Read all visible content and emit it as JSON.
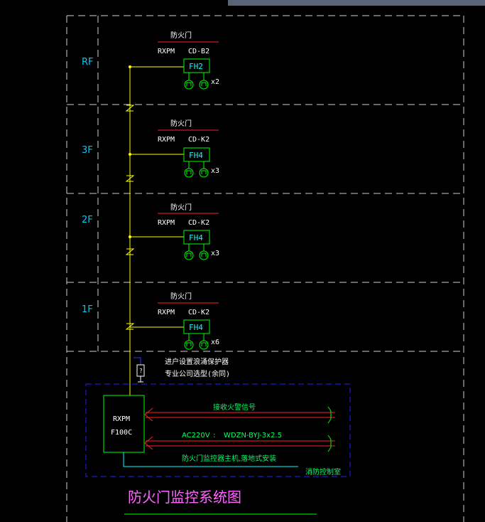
{
  "top_bar_color": "#5a6478",
  "floors": [
    {
      "label": "RF",
      "title": "防火门",
      "model": "RXPM",
      "code": "CD-B2",
      "box": "FH2",
      "qty": "x2"
    },
    {
      "label": "3F",
      "title": "防火门",
      "model": "RXPM",
      "code": "CD-K2",
      "box": "FH4",
      "qty": "x3"
    },
    {
      "label": "2F",
      "title": "防火门",
      "model": "RXPM",
      "code": "CD-K2",
      "box": "FH4",
      "qty": "x3"
    },
    {
      "label": "1F",
      "title": "防火门",
      "model": "RXPM",
      "code": "CD-K2",
      "box": "FH4",
      "qty": "x6"
    }
  ],
  "note": {
    "line1": "进户设置浪涌保护器",
    "line2": "专业公司选型(余同)"
  },
  "controller": {
    "line1": "RXPM",
    "line2": "F100C"
  },
  "signals": {
    "fire_alarm": "接收火警信号",
    "power_prefix": "AC220V",
    "power_sep": ":",
    "power_cable": "WDZN-BYJ-3x2.5",
    "host_note": "防火门监控器主机,落地式安装",
    "room": "消防控制室"
  },
  "title": "防火门监控系统图",
  "colors": {
    "wire": "#ffff00",
    "box": "#00ff00",
    "red": "#ff2020",
    "cyan": "#00ffff",
    "frame": "#c8c8c8",
    "blue_frame": "#2020ff"
  }
}
